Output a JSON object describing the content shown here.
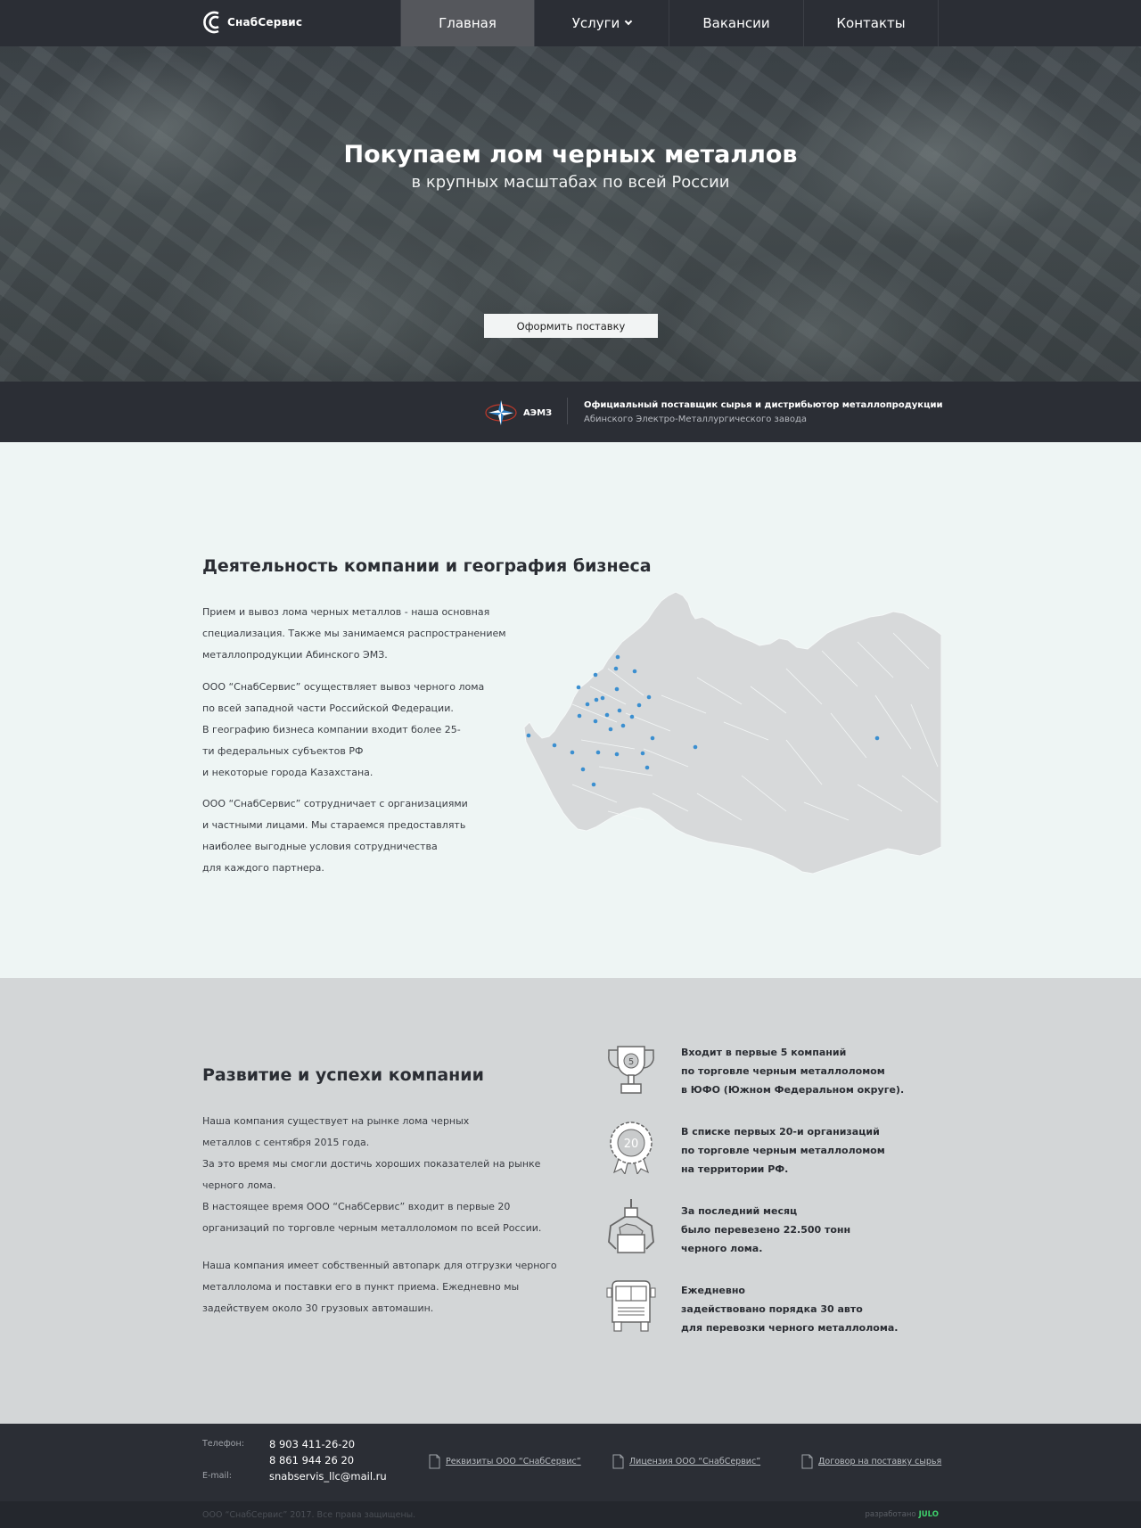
{
  "brand": {
    "name": "СнабСервис"
  },
  "nav": {
    "items": [
      {
        "label": "Главная"
      },
      {
        "label": "Услуги"
      },
      {
        "label": "Вакансии"
      },
      {
        "label": "Контакты"
      }
    ]
  },
  "hero": {
    "title": "Покупаем лом черных металлов",
    "subtitle": "в крупных масштабах по всей России",
    "button": "Оформить поставку"
  },
  "partner": {
    "name": "АЭМЗ",
    "line1": "Официальный поставщик сырья и дистрибьютор металлопродукции",
    "line2": "Абинского Электро-Металлургического завода"
  },
  "activity": {
    "title": "Деятельность компании и география бизнеса",
    "paragraphs": [
      [
        "Прием и вывоз лома черных металлов - наша основная",
        "специализация. Также мы занимаемся распространением",
        "металлопродукции Абинского ЭМЗ."
      ],
      [
        "ООО “СнабСервис” осуществляет вывоз черного лома",
        "по всей западной части Российской Федерации.",
        "В географию бизнеса компании входит более 25-",
        "ти федеральных субъектов РФ",
        "и некоторые города Казахстана."
      ],
      [
        "ООО “СнабСервис” сотрудничает с организациями",
        "и частными лицами. Мы стараемся предоставлять",
        "наиболее выгодные условия сотрудничества",
        "для каждого партнера."
      ]
    ],
    "map_color": "#d7d9da",
    "dot_color": "#3b8fd0"
  },
  "success": {
    "title": "Развитие и успехи компании",
    "paragraphs": [
      [
        "Наша компания существует на рынке лома черных",
        "металлов с сентября 2015 года.",
        "За это время мы смогли достичь хороших показателей на рынке",
        "черного лома.",
        "В настоящее время ООО “СнабСервис” входит в первые 20",
        "организаций по торговле черным металлоломом по всей России."
      ],
      [
        "Наша компания имеет собственный автопарк для отгрузки черного",
        "металлолома и поставки его в пункт приема. Ежедневно мы",
        "задействуем около 30 грузовых автомашин."
      ]
    ],
    "achievements": [
      {
        "icon": "trophy-icon",
        "badge": "5",
        "lines": [
          "Входит в первые 5 компаний",
          "по торговле черным металлоломом",
          "в ЮФО (Южном Федеральном округе)."
        ]
      },
      {
        "icon": "medal-icon",
        "badge": "20",
        "lines": [
          "В списке первых 20-и организаций",
          "по торговле черным металлоломом",
          "на территории РФ."
        ]
      },
      {
        "icon": "scrap-grabber-icon",
        "badge": "",
        "lines": [
          "За последний месяц",
          "было перевезено 22.500 тонн",
          "черного лома."
        ]
      },
      {
        "icon": "truck-icon",
        "badge": "",
        "lines": [
          "Ежедневно",
          "задействовано порядка 30 авто",
          "для перевозки черного металлолома."
        ]
      }
    ]
  },
  "footer": {
    "phone_label": "Телефон:",
    "phone1": "8 903 411-26-20",
    "phone2": "8 861 944 26 20",
    "email_label": "E-mail:",
    "email": "snabservis_llc@mail.ru",
    "docs": [
      "Реквизиты ООО “СнабСервис”",
      "Лицензия ООО “СнабСервис”",
      "Договор на поставку сырья"
    ],
    "copyright": "ООО “СнабСервис” 2017. Все права защищены.",
    "dev_label": "разработано",
    "dev_name": "JULO"
  }
}
